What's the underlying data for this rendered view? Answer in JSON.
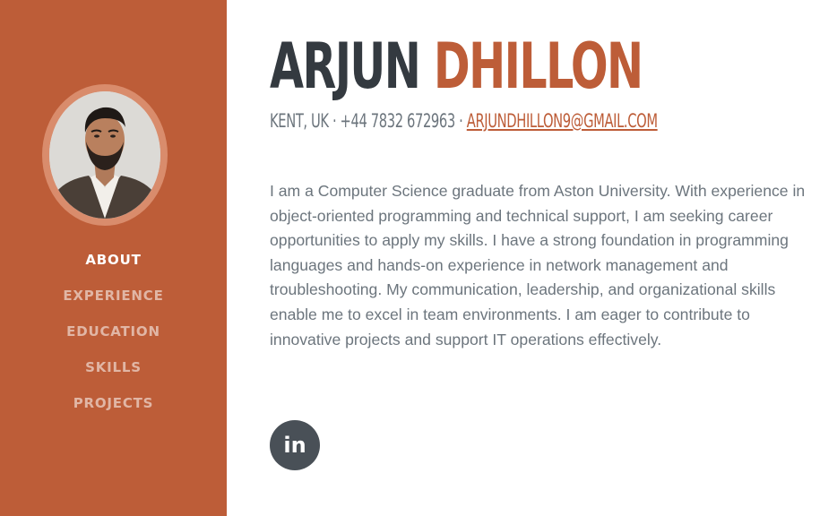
{
  "profile": {
    "first_name": "ARJUN",
    "last_name": "DHILLON",
    "location_phone": "KENT, UK · +44 7832 672963 · ",
    "email": "ARJUNDHILLON9@GMAIL.COM",
    "about": "I am a Computer Science graduate from Aston University. With experience in object-oriented programming and technical support, I am seeking career opportunities to apply my skills. I have a strong foundation in programming languages and hands-on experience in network management and troubleshooting. My communication, leadership, and organizational skills enable me to excel in team environments. I am eager to contribute to innovative projects and support IT operations effectively."
  },
  "nav": {
    "items": [
      {
        "label": "ABOUT",
        "active": true
      },
      {
        "label": "EXPERIENCE",
        "active": false
      },
      {
        "label": "EDUCATION",
        "active": false
      },
      {
        "label": "SKILLS",
        "active": false
      },
      {
        "label": "PROJECTS",
        "active": false
      }
    ]
  },
  "social": {
    "linkedin_label": "in",
    "icon": "linkedin-icon"
  },
  "colors": {
    "accent": "#bd5d38",
    "text_dark": "#343a40",
    "text_muted": "#6c757d",
    "social_bg": "#495057"
  }
}
